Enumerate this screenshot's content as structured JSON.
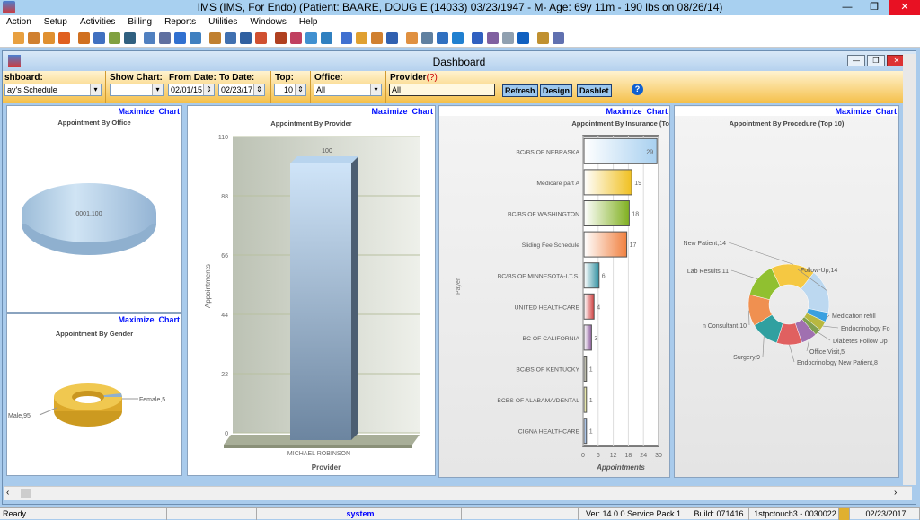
{
  "window": {
    "title": "IMS (IMS, For Endo)    (Patient: BAARE, DOUG E (14033) 03/23/1947 - M- Age: 69y 11m  - 190 lbs on 08/26/14)",
    "minimize": "—",
    "restore": "❐",
    "close": "✕",
    "close_color": "#e81123"
  },
  "menu": [
    "Action",
    "Setup",
    "Activities",
    "Billing",
    "Reports",
    "Utilities",
    "Windows",
    "Help"
  ],
  "toolbar_icon_colors": [
    "#e8a040",
    "#d08030",
    "#e09030",
    "#e06020",
    "#d07020",
    "#4070c0",
    "#80a040",
    "#306080",
    "#5080c0",
    "#6070a0",
    "#3070d0",
    "#4080c0",
    "#c08030",
    "#4070b0",
    "#3060a0",
    "#d05030",
    "#b04020",
    "#c04060",
    "#4090d0",
    "#3080c0",
    "#4070d0",
    "#e0a030",
    "#d08030",
    "#3060b0",
    "#e09040",
    "#6080a0",
    "#3070c0",
    "#2080d0",
    "#3060c0",
    "#8060a0",
    "#90a0b0",
    "#1060c0",
    "#c09030",
    "#6070b0"
  ],
  "dashboard": {
    "title": "Dashboard",
    "filters": {
      "dashboard_label": "shboard:",
      "dashboard_value": "ay's Schedule",
      "show_chart_label": "Show Chart:",
      "show_chart_value": "",
      "from_label": "From Date:",
      "from_value": "02/01/15",
      "to_label": "To Date:",
      "to_value": "02/23/17",
      "top_label": "Top:",
      "top_value": "10",
      "office_label": "Office:",
      "office_value": "All",
      "provider_label": "Provider",
      "provider_hint": "(?)",
      "provider_value": "All"
    },
    "buttons": {
      "refresh": "Refresh",
      "design": "Design",
      "dashlet": "Dashlet",
      "help": "?"
    },
    "maximize": "Maximize",
    "chart": "Chart"
  },
  "chart_data": [
    {
      "type": "pie",
      "title": "Appointment By Office",
      "labels": [
        "0001"
      ],
      "values": [
        100
      ],
      "data_labels": [
        "0001,100"
      ]
    },
    {
      "type": "pie",
      "title": "Appointment By Gender",
      "labels": [
        "Male",
        "Female"
      ],
      "values": [
        95,
        5
      ],
      "data_labels": [
        "Male,95",
        "Female,5"
      ],
      "colors": [
        "#e8b030",
        "#8fb0d0"
      ]
    },
    {
      "type": "bar",
      "title": "Appointment By Provider",
      "categories": [
        "MICHAEL ROBINSON"
      ],
      "values": [
        100
      ],
      "data_labels": [
        "100"
      ],
      "xlabel": "Provider",
      "ylabel": "Appointments",
      "ylim": [
        0,
        110
      ],
      "yticks": [
        "0",
        "22",
        "44",
        "66",
        "88",
        "110"
      ],
      "grid": true
    },
    {
      "type": "bar",
      "orientation": "horizontal",
      "title": "Appointment By Insurance (To",
      "categories": [
        "BC/BS OF NEBRASKA",
        "Medicare part A",
        "BC/BS OF WASHINGTON",
        "Sliding Fee Schedule",
        "BC/BS OF MINNESOTA-I.T.S.",
        "UNITED HEALTHCARE",
        "BC OF CALIFORNIA",
        "BC/BS OF KENTUCKY",
        "BCBS OF ALABAMA/DENTAL",
        "CIGNA HEALTHCARE"
      ],
      "values": [
        29,
        19,
        18,
        17,
        6,
        4,
        3,
        1,
        1,
        1
      ],
      "colors": [
        "#a8d0f0",
        "#f0c020",
        "#80b020",
        "#f08040",
        "#3090a0",
        "#d04040",
        "#9060a0",
        "#808060",
        "#d0d060",
        "#6090d0"
      ],
      "xlabel": "Appointments",
      "ylabel": "Payer",
      "xlim": [
        0,
        30
      ],
      "xticks": [
        "0",
        "6",
        "12",
        "18",
        "24",
        "30"
      ],
      "grid": true
    },
    {
      "type": "pie",
      "subtype": "donut",
      "title": "Appointment By Procedure (Top 10)",
      "labels": [
        "New Patient",
        "Follow-Up",
        "Medication refill",
        "Endocrinology Fo",
        "Diabetes Follow Up",
        "Office Visit",
        "Endocrinology New Patient",
        "Surgery",
        "n Consultant",
        "Lab Results"
      ],
      "values": [
        14,
        14,
        3,
        3,
        2,
        5,
        8,
        9,
        10,
        11
      ],
      "data_labels": [
        "New Patient,14",
        "Follow-Up,14",
        "Medication refill",
        "Endocrinology Fo",
        "Diabetes Follow Up",
        "Office Visit,5",
        "Endocrinology New Patient,8",
        "Surgery,9",
        "n Consultant,10",
        "Lab Results,11"
      ],
      "colors": [
        "#f5c842",
        "#bcd8f0",
        "#3aa0e0",
        "#b8b840",
        "#80a050",
        "#a070b0",
        "#e06060",
        "#30a0a0",
        "#f09050",
        "#90c030"
      ]
    }
  ],
  "status": {
    "ready": "Ready",
    "user": "system",
    "version": "Ver: 14.0.0 Service Pack 1",
    "build": "Build: 071416",
    "station": "1stpctouch3 - 0030022",
    "date": "02/23/2017"
  }
}
